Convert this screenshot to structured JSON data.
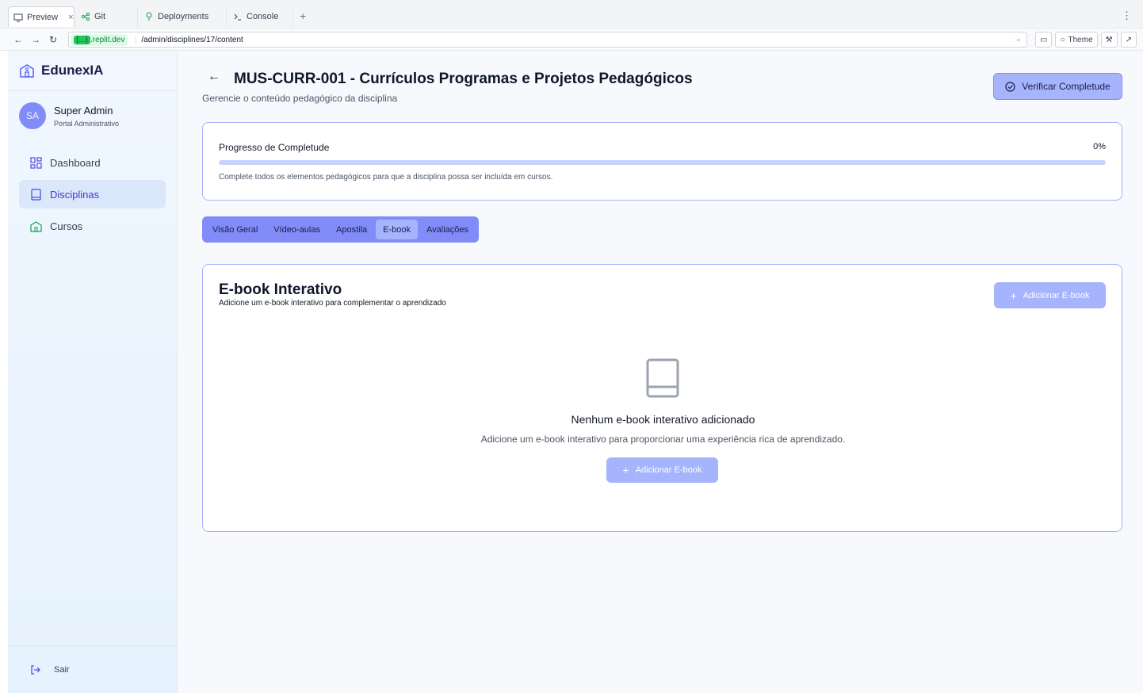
{
  "browser": {
    "tabs": [
      {
        "label": "Preview",
        "close": "×"
      },
      {
        "label": "Git"
      },
      {
        "label": "Deployments"
      },
      {
        "label": "Console"
      }
    ],
    "add_tab": "+",
    "menu": "⋮",
    "domain_chip": "{...}",
    "domain": ".replit.dev",
    "url_path": "/admin/disciplines/17/content",
    "theme_label": "Theme"
  },
  "sidebar": {
    "brand": "EdunexIA",
    "user": {
      "initials": "SA",
      "name": "Super Admin",
      "role": "Portal Administrativo"
    },
    "items": [
      {
        "label": "Dashboard",
        "icon": "grid-icon"
      },
      {
        "label": "Disciplinas",
        "icon": "book-icon",
        "active": true
      },
      {
        "label": "Cursos",
        "icon": "school-icon"
      }
    ],
    "logout": "Sair"
  },
  "header": {
    "title": "MUS-CURR-001 - Currículos Programas e Projetos Pedagógicos",
    "subtitle": "Gerencie o conteúdo pedagógico da disciplina",
    "verify_button": "Verificar Completude"
  },
  "progress": {
    "title": "Progresso de Completude",
    "percent_label": "0%",
    "value": 0,
    "note": "Complete todos os elementos pedagógicos para que a disciplina possa ser incluída em cursos."
  },
  "tabs": [
    {
      "label": "Visão Geral"
    },
    {
      "label": "Vídeo-aulas"
    },
    {
      "label": "Apostila"
    },
    {
      "label": "E-book",
      "active": true
    },
    {
      "label": "Avaliações"
    }
  ],
  "ebook": {
    "title": "E-book Interativo",
    "subtitle": "Adicione um e-book interativo para complementar o aprendizado",
    "add_button": "Adicionar E-book",
    "empty_title": "Nenhum e-book interativo adicionado",
    "empty_subtitle": "Adicione um e-book interativo para proporcionar uma experiência rica de aprendizado.",
    "empty_button": "Adicionar E-book"
  },
  "colors": {
    "accent": "#818cf8",
    "accent_light": "#a5b4fc",
    "border": "#a5b4fc"
  }
}
